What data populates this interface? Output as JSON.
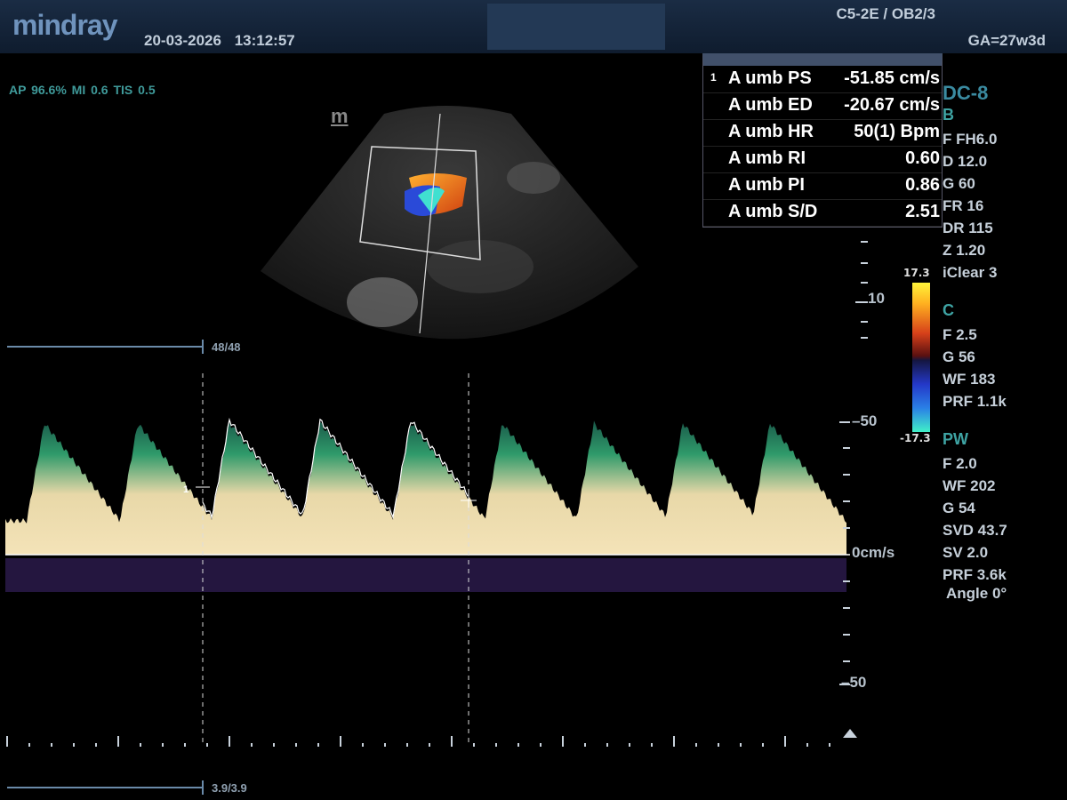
{
  "header": {
    "brand": "mindray",
    "date": "20-03-2026",
    "time": "13:12:57",
    "probe_exam": "C5-2E / OB2/3",
    "gestational_age": "GA=27w3d"
  },
  "acoustic": {
    "ap": "AP 96.6%",
    "mi": "MI 0.6",
    "tis": "TIS 0.5"
  },
  "image_marker": "m",
  "measurements": {
    "index": "1",
    "rows": [
      {
        "name": "A umb PS",
        "value": "-51.85 cm/s"
      },
      {
        "name": "A umb ED",
        "value": "-20.67 cm/s"
      },
      {
        "name": "A umb HR",
        "value": "50(1) Bpm"
      },
      {
        "name": "A umb RI",
        "value": "0.60"
      },
      {
        "name": "A umb PI",
        "value": "0.86"
      },
      {
        "name": "A umb S/D",
        "value": "2.51"
      }
    ]
  },
  "params": {
    "preset": "DC-8",
    "b_mode": {
      "label": "B",
      "items": [
        "F FH6.0",
        "D 12.0",
        "G 60",
        "FR 16",
        "DR 115",
        "Z 1.20",
        "iClear 3"
      ]
    },
    "c_mode": {
      "label": "C",
      "items": [
        "F 2.5",
        "G 56",
        "WF 183",
        "PRF 1.1k"
      ]
    },
    "pw_mode": {
      "label": "PW",
      "items": [
        "F 2.0",
        "WF 202",
        "G 54",
        "SVD 43.7",
        "SV 2.0",
        "PRF 3.6k",
        "Angle  0°"
      ]
    }
  },
  "color_scale": {
    "max": "17.3",
    "min": "-17.3"
  },
  "depth_scale": {
    "mark": "10"
  },
  "doppler_scale": {
    "upper": "50",
    "baseline": "0cm/s",
    "lower": "50"
  },
  "sweep": {
    "top_counter": "48/48",
    "bottom_counter": "3.9/3.9",
    "cursor_label": "1"
  },
  "colors": {
    "background": "#000000",
    "header": "#1a2c44",
    "accent_teal": "#3ea3a3",
    "spectrum_bright": "#f4e3b8",
    "spectrum_green": "#2f9a6a"
  }
}
